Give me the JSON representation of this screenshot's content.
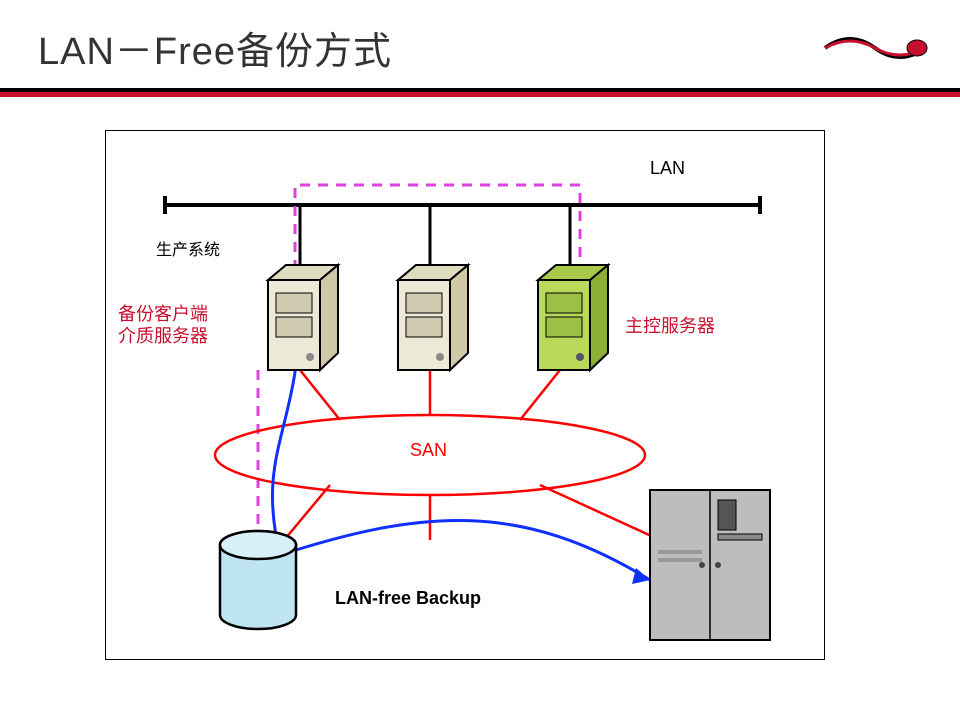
{
  "title": "LAN－Free备份方式",
  "labels": {
    "lan": "LAN",
    "production_system": "生产系统",
    "backup_client_line1": "备份客户端",
    "backup_client_line2": "介质服务器",
    "master_server": "主控服务器",
    "san": "SAN",
    "lanfree": "LAN-free Backup"
  },
  "diagram": {
    "elements": {
      "lan_bus": "horizontal Ethernet bus",
      "servers": [
        {
          "role": "backup-client-media-server",
          "color": "beige"
        },
        {
          "role": "generic-server",
          "color": "beige"
        },
        {
          "role": "master-server",
          "color": "green"
        }
      ],
      "san_ring": "red oval SAN fabric connecting all servers, storage and tape",
      "storage_cylinder": "blue disk storage",
      "tape_library": "grey tape library cabinet",
      "control_path": "magenta dashed line across LAN",
      "data_path": "blue curve from server1 via storage to tape (LAN-free)"
    }
  },
  "logo_alt": "CommVault logo"
}
